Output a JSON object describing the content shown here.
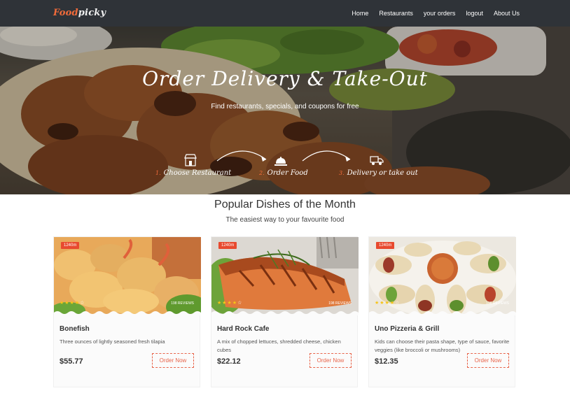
{
  "brand": {
    "name_orange": "Food",
    "name_white": "picky"
  },
  "nav": {
    "items": [
      "Home",
      "Restaurants",
      "your orders",
      "logout",
      "About Us"
    ]
  },
  "hero": {
    "title": "Order Delivery & Take-Out",
    "subtitle": "Find restaurants, specials, and coupons for free",
    "steps": [
      {
        "num": "1.",
        "label": "Choose Restaurant",
        "icon": "store-icon"
      },
      {
        "num": "2.",
        "label": "Order Food",
        "icon": "cloche-icon"
      },
      {
        "num": "3.",
        "label": "Delivery or take out",
        "icon": "delivery-truck-icon"
      }
    ]
  },
  "section": {
    "title": "Popular Dishes of the Month",
    "subtitle": "The easiest way to your favourite food"
  },
  "cards": [
    {
      "badge": "1240m",
      "rating": 4,
      "reviews": "198 REVIEWS",
      "name": "Bonefish",
      "desc": "Three ounces of lightly seasoned fresh tilapia",
      "price": "$55.77",
      "button": "Order Now"
    },
    {
      "badge": "1240m",
      "rating": 4,
      "reviews": "198 REVIEWS",
      "name": "Hard Rock Cafe",
      "desc": "A mix of chopped lettuces, shredded cheese, chicken cubes",
      "price": "$22.12",
      "button": "Order Now"
    },
    {
      "badge": "1240m",
      "rating": 4,
      "reviews": "198 REVIEWS",
      "name": "Uno Pizzeria & Grill",
      "desc": "Kids can choose their pasta shape, type of sauce, favorite veggies (like broccoli or mushrooms)",
      "price": "$12.35",
      "button": "Order Now"
    }
  ],
  "colors": {
    "accent": "#f26b3a",
    "navbar": "#2f3338",
    "star": "#f6c417",
    "badge": "#e84a2f"
  }
}
